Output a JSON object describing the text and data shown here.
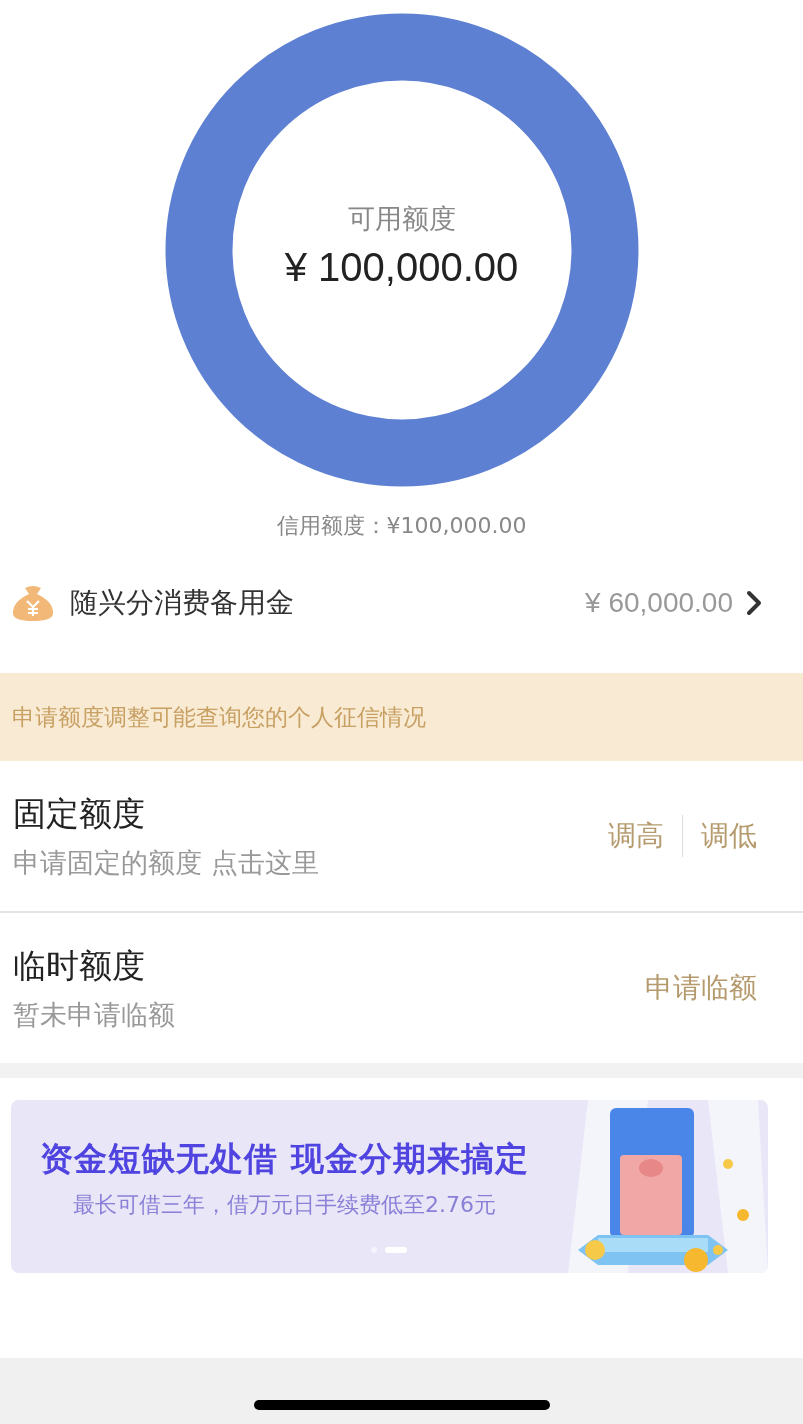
{
  "credit_ring": {
    "label": "可用额度",
    "amount": "¥ 100,000.00"
  },
  "credit_limit": "信用额度：¥100,000.00",
  "reserve_row": {
    "title": "随兴分消费备用金",
    "amount": "¥ 60,000.00"
  },
  "notice": "申请额度调整可能查询您的个人征信情况",
  "limits": [
    {
      "title": "固定额度",
      "subtitle": "申请固定的额度 点击这里",
      "actions": [
        "调高",
        "调低"
      ]
    },
    {
      "title": "临时额度",
      "subtitle": "暂未申请临额",
      "actions": [
        "申请临额"
      ]
    }
  ],
  "banner": {
    "headline": "资金短缺无处借 现金分期来搞定",
    "subline": "最长可借三年，借万元日手续费低至2.76元",
    "dots": [
      {
        "selected": false
      },
      {
        "selected": true
      }
    ]
  }
}
